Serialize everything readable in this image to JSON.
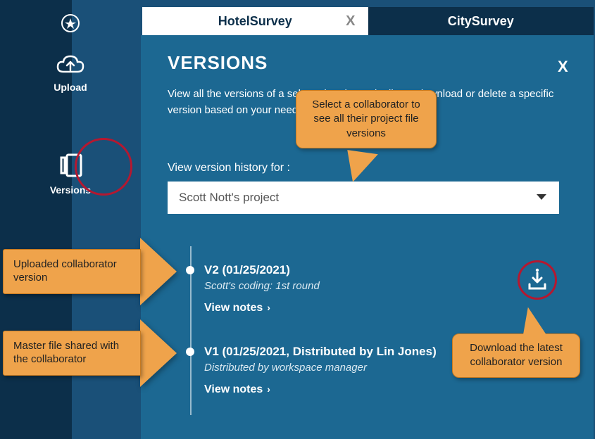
{
  "tabs": [
    {
      "label": "HotelSurvey",
      "active": true
    },
    {
      "label": "CitySurvey",
      "active": false
    }
  ],
  "sidebar": {
    "upload_label": "Upload",
    "versions_label": "Versions"
  },
  "panel": {
    "title": "VERSIONS",
    "close": "X",
    "description": "View all the versions of a selected project. Distribute, download or delete a specific version based on your needs.",
    "history_label": "View version history for :",
    "dropdown_value": "Scott Nott's project"
  },
  "timeline": [
    {
      "title": "V2 (01/25/2021)",
      "subtitle": "Scott's coding: 1st round",
      "link": "View notes"
    },
    {
      "title": "V1 (01/25/2021, Distributed by Lin Jones)",
      "subtitle": "Distributed by workspace manager",
      "link": "View notes"
    }
  ],
  "callouts": {
    "uploaded": "Uploaded collaborator version",
    "master": "Master file shared with the collaborator",
    "select_collab": "Select a collaborator to see all their project file versions",
    "download_latest": "Download the latest collaborator version"
  }
}
